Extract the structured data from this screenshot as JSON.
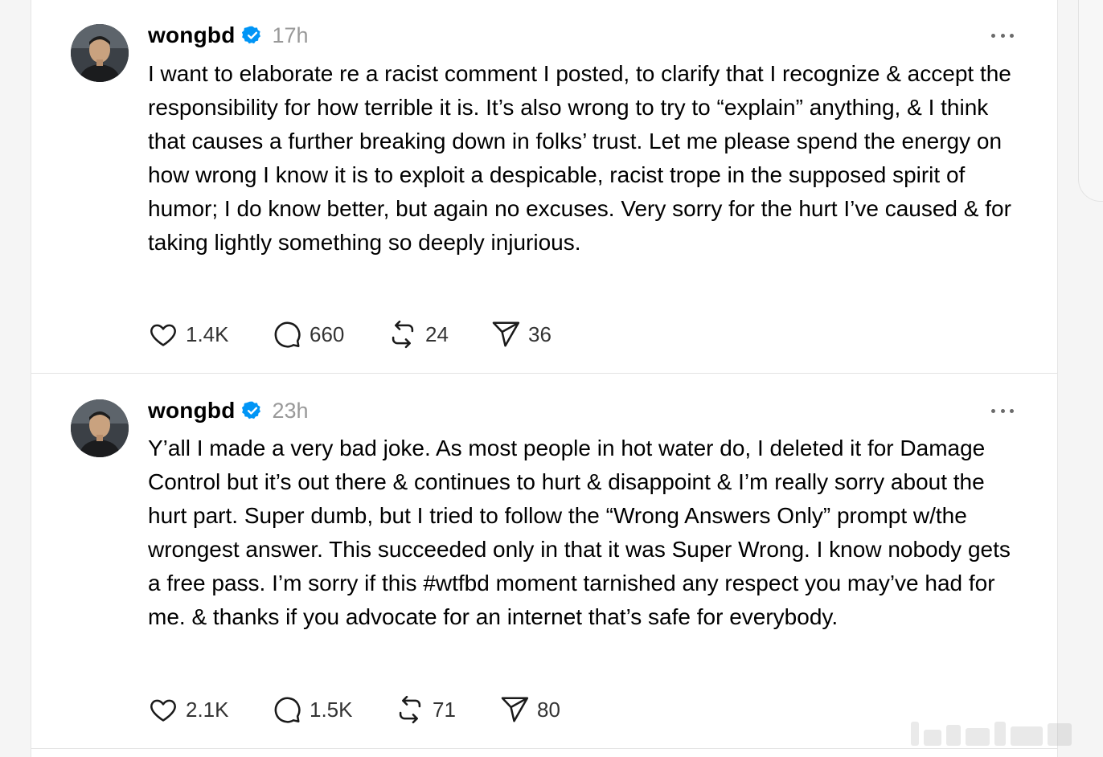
{
  "posts": [
    {
      "username": "wongbd",
      "time": "17h",
      "text": "I want to elaborate re a racist comment I posted, to clarify that I recognize & accept the responsibility for how terrible it is. It’s also wrong to try to “explain” anything, & I think that causes a further breaking down in folks’ trust. Let me please spend the energy on how wrong I know it is to exploit a despicable, racist trope in the supposed spirit of humor; I do know better, but again no excuses. Very sorry for the hurt I’ve caused & for taking lightly something so deeply injurious.",
      "likes": "1.4K",
      "replies": "660",
      "reposts": "24",
      "shares": "36"
    },
    {
      "username": "wongbd",
      "time": "23h",
      "text": "Y’all I made a very bad joke. As most people in hot water do, I deleted it for Damage Control but it’s out there & continues to hurt & disappoint & I’m really sorry about the hurt part. Super dumb, but I tried to follow the “Wrong Answers Only” prompt w/the wrongest answer. This succeeded only in that it was Super Wrong. I know nobody gets a free pass. I’m sorry if this #wtfbd moment tarnished any respect you may’ve had for me. & thanks if you advocate for an internet that’s safe for everybody.",
      "likes": "2.1K",
      "replies": "1.5K",
      "reposts": "71",
      "shares": "80"
    }
  ],
  "icons": {
    "verified": "verified-badge-icon",
    "more": "more-options-icon",
    "like": "heart-icon",
    "reply": "comment-icon",
    "repost": "repost-icon",
    "share": "send-icon"
  },
  "colors": {
    "verified": "#0095f6",
    "muted": "#999999",
    "icon": "#1a1a1a"
  }
}
